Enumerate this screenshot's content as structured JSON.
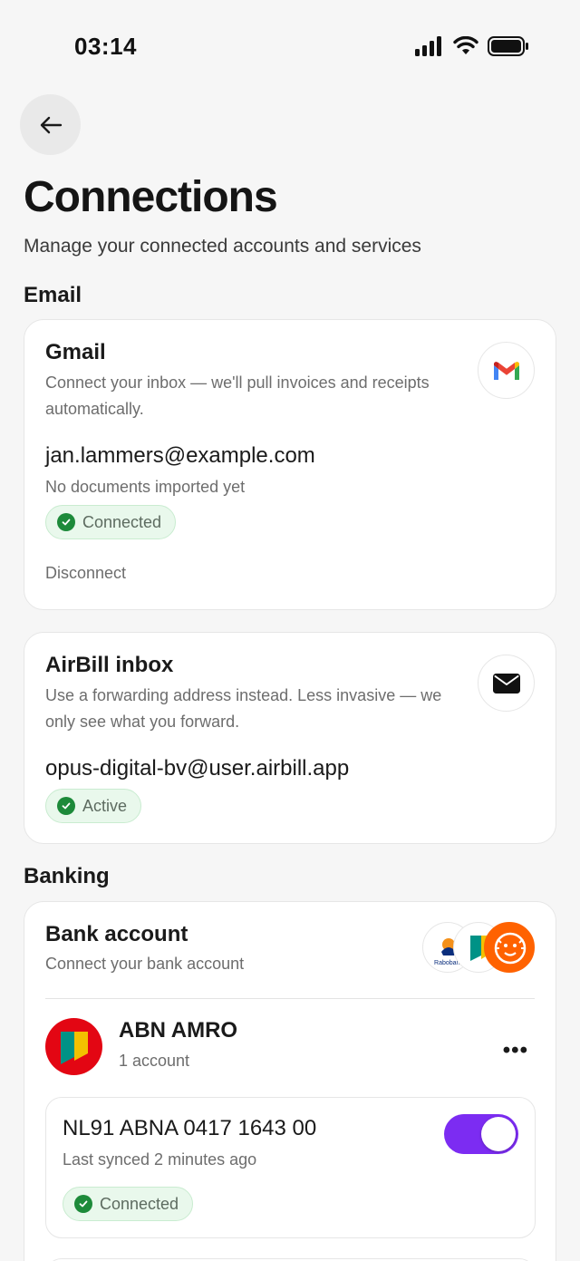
{
  "status_bar": {
    "time": "03:14"
  },
  "header": {
    "title": "Connections",
    "subtitle": "Manage your connected accounts and services"
  },
  "sections": {
    "email": "Email",
    "banking": "Banking"
  },
  "gmail": {
    "title": "Gmail",
    "description": "Connect your inbox — we'll pull invoices and receipts automatically.",
    "account": "jan.lammers@example.com",
    "documents": "No documents imported yet",
    "status": "Connected",
    "action": "Disconnect"
  },
  "airbill": {
    "title": "AirBill inbox",
    "description": "Use a forwarding address instead. Less invasive — we only see what you forward.",
    "address": "opus-digital-bv@user.airbill.app",
    "status": "Active"
  },
  "bank": {
    "title": "Bank account",
    "description": "Connect your bank account",
    "logos": [
      "rabobank-logo",
      "abn-amro-logo",
      "ing-logo"
    ],
    "rabobank_logo_text": "Rabobank",
    "provider": {
      "name": "ABN AMRO",
      "accounts": "1 account",
      "more_label": "•••"
    },
    "account": {
      "iban": "NL91 ABNA 0417 1643 00",
      "synced": "Last synced 2 minutes ago",
      "status": "Connected",
      "enabled": true
    }
  },
  "colors": {
    "accent": "#7c2cf2",
    "success": "#1d8a3a",
    "success_bg": "#e9f8ec",
    "abn_red": "#e30613",
    "ing_orange": "#ff6200"
  }
}
